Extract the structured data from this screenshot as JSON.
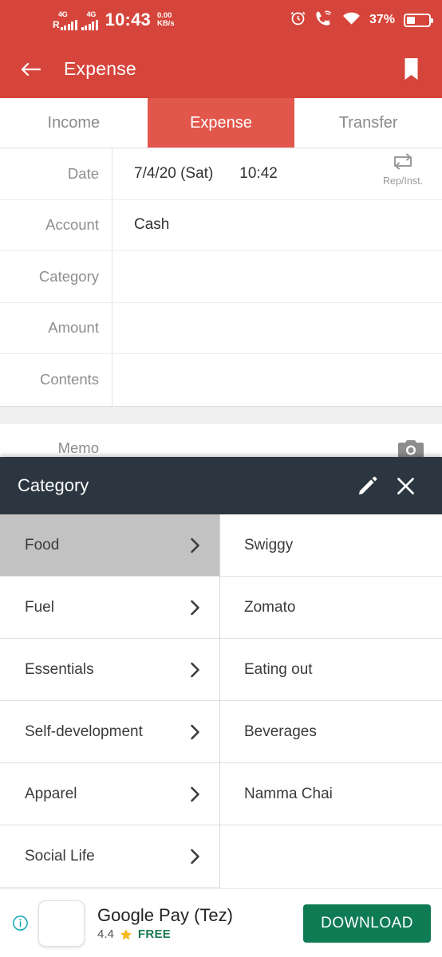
{
  "status_bar": {
    "network_1": {
      "tech": "4G",
      "roaming": "R"
    },
    "network_2": {
      "tech": "4G"
    },
    "time": "10:43",
    "net_speed_value": "0.00",
    "net_speed_unit": "KB/s",
    "alarm_icon": "alarm-icon",
    "call_icon": "vowifi-call-icon",
    "call_sim_badge": "2",
    "wifi_icon": "wifi-icon",
    "battery_percent": "37%"
  },
  "app_bar": {
    "back_icon": "back-arrow-icon",
    "title": "Expense",
    "bookmark_icon": "bookmark-icon"
  },
  "tabs": [
    {
      "label": "Income",
      "active": false
    },
    {
      "label": "Expense",
      "active": true
    },
    {
      "label": "Transfer",
      "active": false
    }
  ],
  "form": {
    "rows": [
      {
        "label": "Date",
        "value": "7/4/20 (Sat)",
        "value2": "10:42"
      },
      {
        "label": "Account",
        "value": "Cash",
        "value2": ""
      },
      {
        "label": "Category",
        "value": "",
        "value2": ""
      },
      {
        "label": "Amount",
        "value": "",
        "value2": ""
      },
      {
        "label": "Contents",
        "value": "",
        "value2": ""
      }
    ],
    "repeat_button": {
      "icon": "repeat-icon",
      "label": "Rep/Inst."
    },
    "memo_row": {
      "label": "Memo",
      "camera_icon": "camera-icon"
    }
  },
  "dialog": {
    "title": "Category",
    "edit_icon": "pencil-icon",
    "close_icon": "close-icon",
    "categories": [
      {
        "name": "Food",
        "selected": true,
        "chevron": "chevron-right-icon"
      },
      {
        "name": "Fuel",
        "selected": false,
        "chevron": "chevron-right-icon"
      },
      {
        "name": "Essentials",
        "selected": false,
        "chevron": "chevron-right-icon"
      },
      {
        "name": "Self-development",
        "selected": false,
        "chevron": "chevron-right-icon"
      },
      {
        "name": "Apparel",
        "selected": false,
        "chevron": "chevron-right-icon"
      },
      {
        "name": "Social Life",
        "selected": false,
        "chevron": "chevron-right-icon"
      }
    ],
    "subcategories": [
      "Swiggy",
      "Zomato",
      "Eating out",
      "Beverages",
      "Namma Chai"
    ]
  },
  "ad": {
    "info_icon": "ad-info-icon",
    "thumbnail": "app-icon",
    "title": "Google Pay (Tez)",
    "rating": "4.4",
    "star_icon": "star-icon",
    "price": "FREE",
    "cta_label": "DOWNLOAD"
  },
  "colors": {
    "brand_red": "#d6453b",
    "tab_active_red": "#e2574c",
    "dialog_header": "#2b3640",
    "selected_row": "#c2c2c2",
    "download_green": "#0f7b55",
    "free_green": "#1b7a52",
    "star_yellow": "#f5b91a",
    "info_teal": "#14a5b8"
  }
}
